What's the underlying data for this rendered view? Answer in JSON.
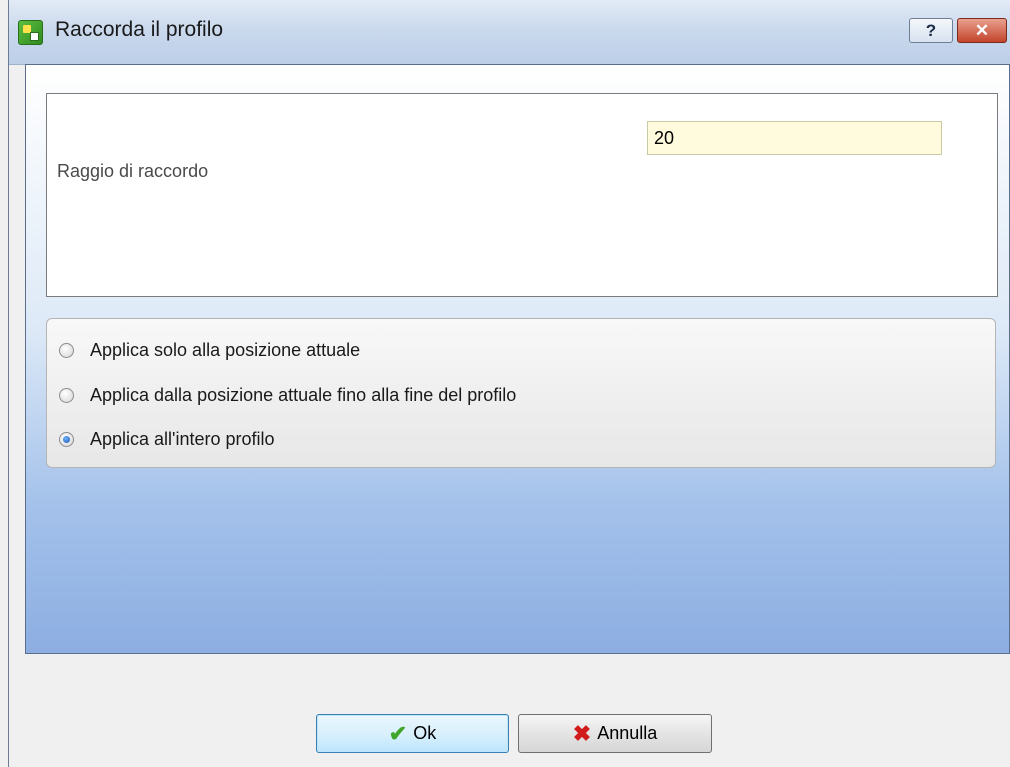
{
  "window": {
    "title": "Raccorda il profilo",
    "help_glyph": "?",
    "close_glyph": "✕"
  },
  "params": {
    "radius_label": "Raggio di raccordo",
    "radius_value": "20"
  },
  "apply_options": [
    {
      "label": "Applica solo alla posizione attuale",
      "checked": false
    },
    {
      "label": "Applica dalla posizione attuale fino alla fine del profilo",
      "checked": false
    },
    {
      "label": "Applica all'intero profilo",
      "checked": true
    }
  ],
  "buttons": {
    "ok_label": "Ok",
    "cancel_label": "Annulla"
  },
  "icons": {
    "app": "app-icon",
    "ok": "checkmark-icon",
    "cancel": "x-icon"
  },
  "colors": {
    "input_bg": "#fffbdc",
    "content_gradient_bottom": "#8daee2"
  }
}
